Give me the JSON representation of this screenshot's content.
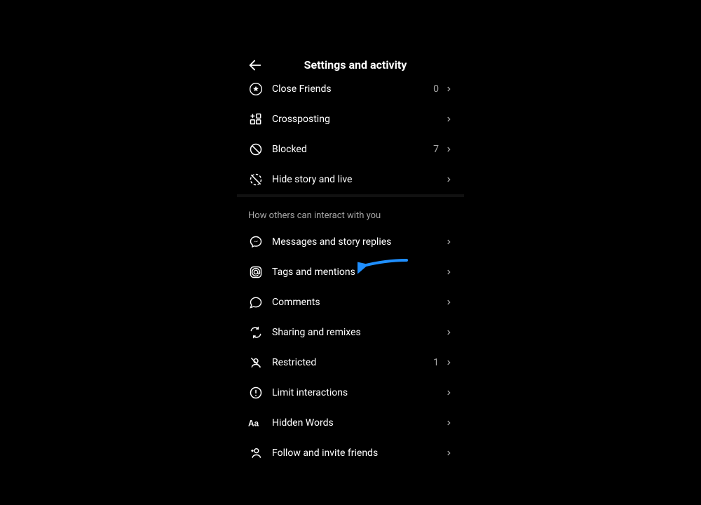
{
  "header": {
    "title": "Settings and activity"
  },
  "sections": {
    "top_rows": [
      {
        "label": "Close Friends",
        "value": "0"
      },
      {
        "label": "Crossposting",
        "value": ""
      },
      {
        "label": "Blocked",
        "value": "7"
      },
      {
        "label": "Hide story and live",
        "value": ""
      }
    ],
    "interact_header": "How others can interact with you",
    "interact_rows": [
      {
        "label": "Messages and story replies",
        "value": ""
      },
      {
        "label": "Tags and mentions",
        "value": ""
      },
      {
        "label": "Comments",
        "value": ""
      },
      {
        "label": "Sharing and remixes",
        "value": ""
      },
      {
        "label": "Restricted",
        "value": "1"
      },
      {
        "label": "Limit interactions",
        "value": ""
      },
      {
        "label": "Hidden Words",
        "value": ""
      },
      {
        "label": "Follow and invite friends",
        "value": ""
      }
    ]
  },
  "colors": {
    "arrow": "#1f8fff"
  }
}
